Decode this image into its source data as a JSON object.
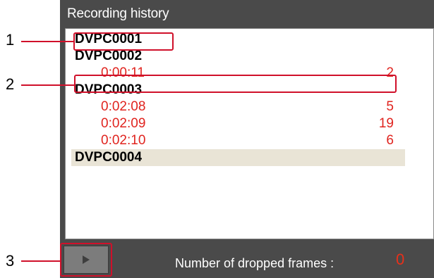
{
  "panel": {
    "title": "Recording history"
  },
  "history": [
    {
      "type": "file",
      "name": "DVPC0001"
    },
    {
      "type": "file",
      "name": "DVPC0002"
    },
    {
      "type": "drop",
      "time": "0:00:11",
      "count": "2"
    },
    {
      "type": "file",
      "name": "DVPC0003"
    },
    {
      "type": "drop",
      "time": "0:02:08",
      "count": "5"
    },
    {
      "type": "drop",
      "time": "0:02:09",
      "count": "19"
    },
    {
      "type": "drop",
      "time": "0:02:10",
      "count": "6"
    },
    {
      "type": "file",
      "name": "DVPC0004",
      "selected": true
    }
  ],
  "footer": {
    "play_icon": "play-icon",
    "dropped_label": "Number of dropped frames :",
    "dropped_value": "0"
  },
  "callouts": [
    "1",
    "2",
    "3"
  ],
  "colors": {
    "panel_bg": "#4a4a4a",
    "drop_text": "#e0241f",
    "callout_line": "#d0102a",
    "selected_row": "#e9e4d6"
  }
}
